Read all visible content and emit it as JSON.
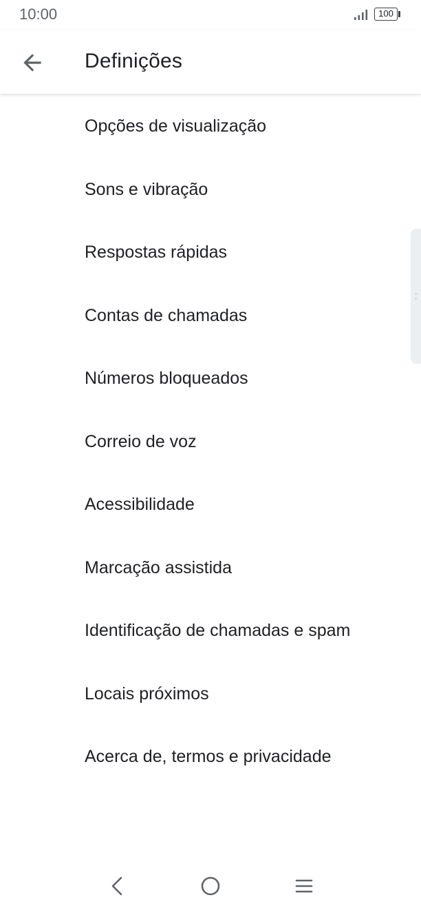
{
  "status_bar": {
    "time": "10:00",
    "battery_level": "100",
    "icons": [
      "signal-icon",
      "battery-icon"
    ]
  },
  "app_bar": {
    "title": "Definições",
    "back_icon": "arrow-back-icon"
  },
  "settings": {
    "items": [
      {
        "label": "Opções de visualização"
      },
      {
        "label": "Sons e vibração"
      },
      {
        "label": "Respostas rápidas"
      },
      {
        "label": "Contas de chamadas"
      },
      {
        "label": "Números bloqueados"
      },
      {
        "label": "Correio de voz"
      },
      {
        "label": "Acessibilidade"
      },
      {
        "label": "Marcação assistida"
      },
      {
        "label": "Identificação de chamadas e spam"
      },
      {
        "label": "Locais próximos"
      },
      {
        "label": "Acerca de, termos e privacidade"
      }
    ]
  },
  "nav_bar": {
    "icons": [
      "nav-back-icon",
      "nav-home-icon",
      "nav-menu-icon"
    ]
  },
  "colors": {
    "text_primary": "#202124",
    "text_secondary": "#5f6368",
    "background": "#ffffff"
  }
}
